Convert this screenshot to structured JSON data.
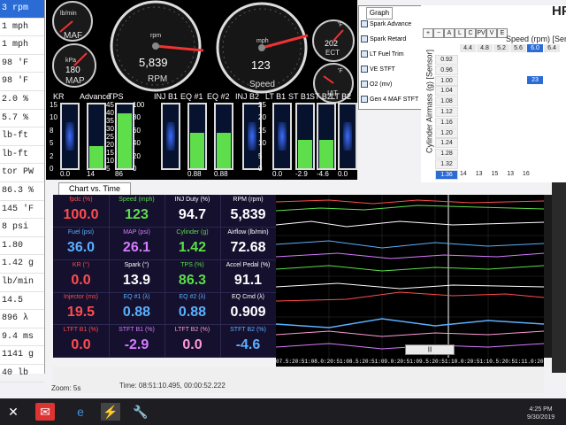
{
  "left_list": [
    "3 rpm",
    "1 mph",
    "1 mph",
    "98 'F",
    "98 'F",
    "2.0 %",
    "5.7 %",
    "lb-ft",
    "lb-ft",
    "tor PW",
    "86.3 %",
    "145 'F",
    "8 psi",
    "1.80",
    "1.42 g",
    "lb/min",
    "14.5 ",
    "896 λ",
    "9.4 ms",
    "1141 g",
    "40 lb"
  ],
  "left_list_selected": 0,
  "gauges": {
    "maf": {
      "label": "MAF",
      "unit": "lb/min"
    },
    "map": {
      "label": "MAP",
      "unit": "kPa",
      "value": "180"
    },
    "rpm": {
      "label": "RPM",
      "unit": "rpm",
      "value": "5,839"
    },
    "speed": {
      "label": "Speed",
      "unit": "mph",
      "value": "123"
    },
    "ect": {
      "label": "ECT",
      "unit": "'F",
      "value": "202"
    },
    "iat": {
      "label": "IAT",
      "unit": "'F"
    }
  },
  "bars": [
    {
      "label": "KR",
      "bottom": "0.0"
    },
    {
      "label": "Advance",
      "bottom": "14"
    },
    {
      "label": "TPS",
      "bottom": "86"
    },
    {
      "label": "INJ B1",
      "bottom": ""
    },
    {
      "label": "EQ #1",
      "bottom": "0.88"
    },
    {
      "label": "EQ #2",
      "bottom": "0.88"
    },
    {
      "label": "INJ B2",
      "bottom": ""
    },
    {
      "label": "LT B1",
      "bottom": "0.0"
    },
    {
      "label": "ST B1",
      "bottom": "-2.9"
    },
    {
      "label": "ST B2",
      "bottom": "-4.6"
    },
    {
      "label": "LT B2",
      "bottom": "0.0"
    }
  ],
  "bar_scales": {
    "kr": [
      "15",
      "10",
      "8",
      "5",
      "2",
      "0"
    ],
    "tps": [
      "100",
      "80",
      "60",
      "40",
      "20",
      "0"
    ],
    "adv": [
      "45",
      "40",
      "35",
      "30",
      "25",
      "20",
      "15",
      "10",
      "5"
    ],
    "inj": [
      "25",
      "20",
      "15",
      "10",
      "5",
      "0"
    ]
  },
  "graph": {
    "tab": "Graph",
    "items": [
      "Spark Advance",
      "Spark Retard",
      "LT Fuel Trim",
      "VE STFT",
      "O2 (mv)",
      "Gen 4 MAF STFT"
    ]
  },
  "table": {
    "toolbar": [
      "+",
      "−",
      "A",
      "L",
      "C",
      "PV",
      "V",
      "E"
    ],
    "col_axis": "Speed (rpm) [Sens",
    "row_axis": "Cylinder Airmass (g) [Sensor]",
    "header": [
      "4.4",
      "4.8",
      "5.2",
      "5.6",
      "6.0",
      "6.4"
    ],
    "row_labels": [
      "0.92",
      "0.96",
      "1.00",
      "1.04",
      "1.08",
      "1.12",
      "1.16",
      "1.20",
      "1.24",
      "1.28",
      "1.32",
      "1.36"
    ],
    "row_values": [
      "",
      "",
      "23",
      "",
      "",
      "",
      "",
      "",
      "",
      "",
      "",
      "14 13 15 13 16"
    ],
    "brand": "HP"
  },
  "chart_tab": "Chart vs. Time",
  "cells": [
    {
      "label": "fpdc (%)",
      "value": "100.0",
      "color": "#ff4d4d"
    },
    {
      "label": "Speed (mph)",
      "value": "123",
      "color": "#5dde4a"
    },
    {
      "label": "INJ Duty (%)",
      "value": "94.7",
      "color": "#ffffff"
    },
    {
      "label": "RPM (rpm)",
      "value": "5,839",
      "color": "#ffffff"
    },
    {
      "label": "Fuel (psi)",
      "value": "36.0",
      "color": "#5ab0ff"
    },
    {
      "label": "MAP (psi)",
      "value": "26.1",
      "color": "#d77bff"
    },
    {
      "label": "Cylinder (g)",
      "value": "1.42",
      "color": "#5dde4a"
    },
    {
      "label": "Airflow (lb/min)",
      "value": "72.68",
      "color": "#ffffff"
    },
    {
      "label": "KR (°)",
      "value": "0.0",
      "color": "#ff4d4d"
    },
    {
      "label": "Spark (°)",
      "value": "13.9",
      "color": "#ffffff"
    },
    {
      "label": "TPS (%)",
      "value": "86.3",
      "color": "#5dde4a"
    },
    {
      "label": "Accel Pedal (%)",
      "value": "91.1",
      "color": "#ffffff"
    },
    {
      "label": "Injector (ms)",
      "value": "19.5",
      "color": "#ff4d4d"
    },
    {
      "label": "EQ #1 (λ)",
      "value": "0.88",
      "color": "#5ab0ff"
    },
    {
      "label": "EQ #2 (λ)",
      "value": "0.88",
      "color": "#5ab0ff"
    },
    {
      "label": "EQ Cmd (λ)",
      "value": "0.909",
      "color": "#ffffff"
    },
    {
      "label": "LTFT B1 (%)",
      "value": "0.0",
      "color": "#ff4d4d"
    },
    {
      "label": "STFT B1 (%)",
      "value": "-2.9",
      "color": "#d77bff"
    },
    {
      "label": "LTFT B2 (%)",
      "value": "0.0",
      "color": "#ff9bd5"
    },
    {
      "label": "STFT B2 (%)",
      "value": "-4.6",
      "color": "#5ab0ff"
    }
  ],
  "chart_ticks": "07.5:20:51:08.0:20:51:08.5:20:51:09.0:20:51:09.5:20:51:10.0:20:51:10.5:20:51:11.0:20:51:11.5:20:51:12.0",
  "status": {
    "zoom": "Zoom: 5s",
    "time": "Time: 08:51:10.495, 00:00:52.222"
  },
  "scroll_label": "|||",
  "clock": {
    "time": "4:25 PM",
    "date": "9/30/2019"
  },
  "taskbar_icons": [
    "start-icon",
    "mail-icon",
    "edge-icon",
    "hp-tuners-icon",
    "wrench-icon"
  ]
}
